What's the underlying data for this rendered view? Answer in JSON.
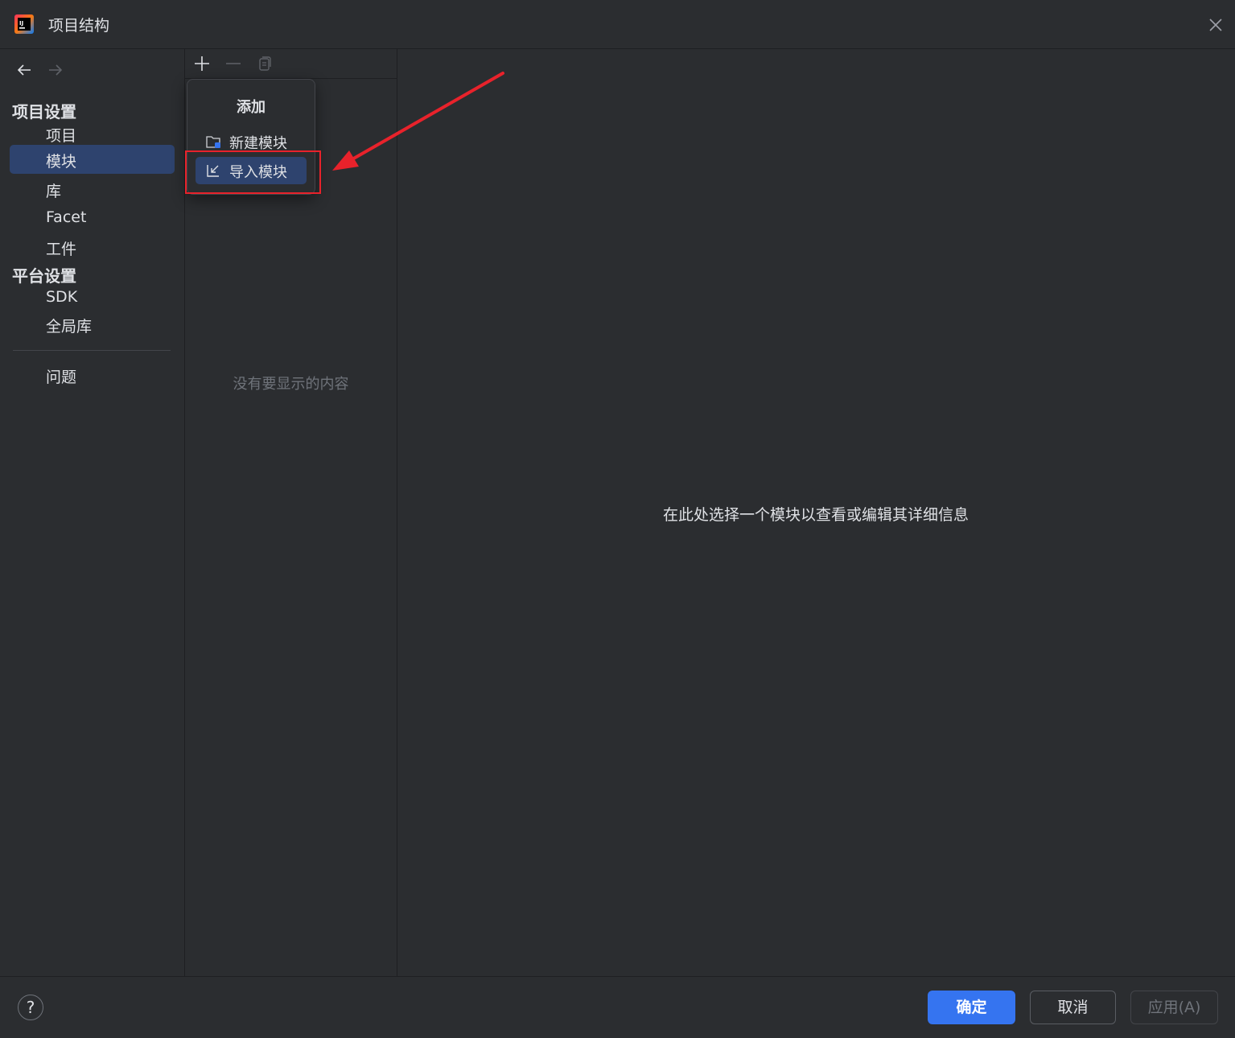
{
  "window": {
    "title": "项目结构"
  },
  "sidebar": {
    "project_settings_title": "项目设置",
    "project_items": [
      {
        "label": "项目",
        "selected": false
      },
      {
        "label": "模块",
        "selected": true
      },
      {
        "label": "库",
        "selected": false
      },
      {
        "label": "Facet",
        "selected": false
      },
      {
        "label": "工件",
        "selected": false
      }
    ],
    "platform_settings_title": "平台设置",
    "platform_items": [
      {
        "label": "SDK"
      },
      {
        "label": "全局库"
      }
    ],
    "problems_label": "问题"
  },
  "module_pane": {
    "toolbar": {
      "add_icon": "plus-icon",
      "remove_icon": "minus-icon",
      "copy_icon": "copy-icon"
    },
    "empty_text": "没有要显示的内容"
  },
  "add_popup": {
    "title": "添加",
    "items": [
      {
        "label": "新建模块",
        "icon": "folder-module-icon",
        "selected": false
      },
      {
        "label": "导入模块",
        "icon": "import-arrow-icon",
        "selected": true
      }
    ]
  },
  "detail_pane": {
    "hint": "在此处选择一个模块以查看或编辑其详细信息"
  },
  "footer": {
    "help_label": "?",
    "ok_label": "确定",
    "cancel_label": "取消",
    "apply_label": "应用(A)",
    "apply_enabled": false
  },
  "colors": {
    "background": "#2b2d30",
    "selection": "#2e436e",
    "accent_button": "#3574f0",
    "annotation_red": "#e8222b"
  }
}
